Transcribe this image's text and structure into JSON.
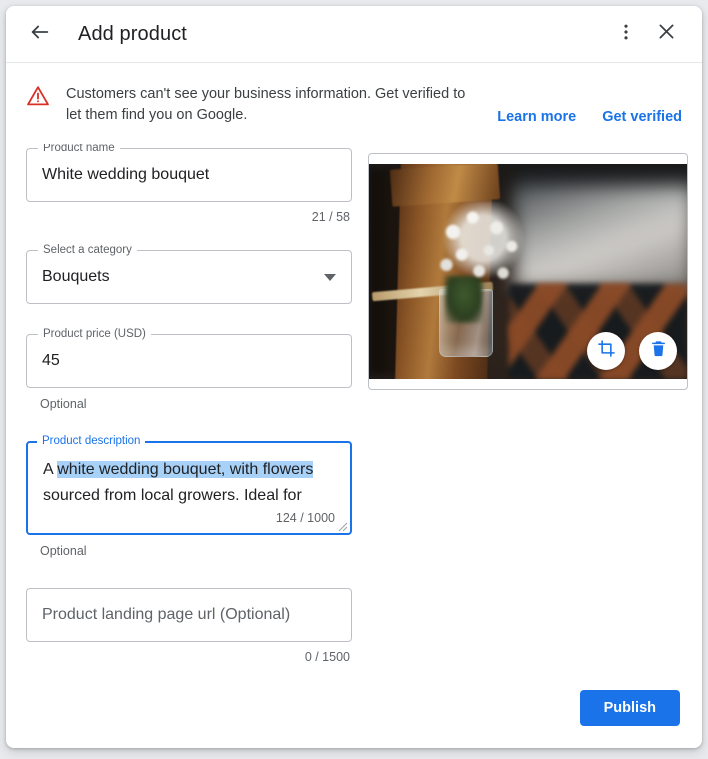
{
  "header": {
    "title": "Add product",
    "back_icon": "arrow-left-icon",
    "more_icon": "more-vert-icon",
    "close_icon": "close-icon"
  },
  "banner": {
    "icon": "warning-triangle-icon",
    "message": "Customers can't see your business information. Get verified to let them find you on Google.",
    "learn_more_label": "Learn more",
    "get_verified_label": "Get verified",
    "link_color": "#1a73e8",
    "icon_color": "#d93025"
  },
  "form": {
    "product_name": {
      "label": "Product name",
      "value": "White wedding bouquet",
      "counter": "21 / 58"
    },
    "category": {
      "label": "Select a category",
      "value": "Bouquets",
      "dropdown_icon": "chevron-down-icon"
    },
    "price": {
      "label": "Product price (USD)",
      "value": "45",
      "helper": "Optional"
    },
    "description": {
      "label": "Product description",
      "line1_prefix": "A ",
      "line1_selected": "white wedding bouquet, with flowers",
      "line2": "sourced from local growers. Ideal for",
      "counter": "124 / 1000",
      "helper": "Optional",
      "focused_border_color": "#1a73e8",
      "selection_color": "#a8d1f7"
    },
    "landing_url": {
      "placeholder": "Product landing page url (Optional)",
      "value": "",
      "counter": "0 / 1500"
    }
  },
  "image_panel": {
    "photo_alt": "White baby's breath bouquet in a glass jar tied to a wooden pew",
    "crop_icon": "crop-icon",
    "delete_icon": "trash-icon",
    "action_color": "#1a73e8"
  },
  "footer": {
    "publish_label": "Publish",
    "publish_color": "#1a73e8"
  }
}
